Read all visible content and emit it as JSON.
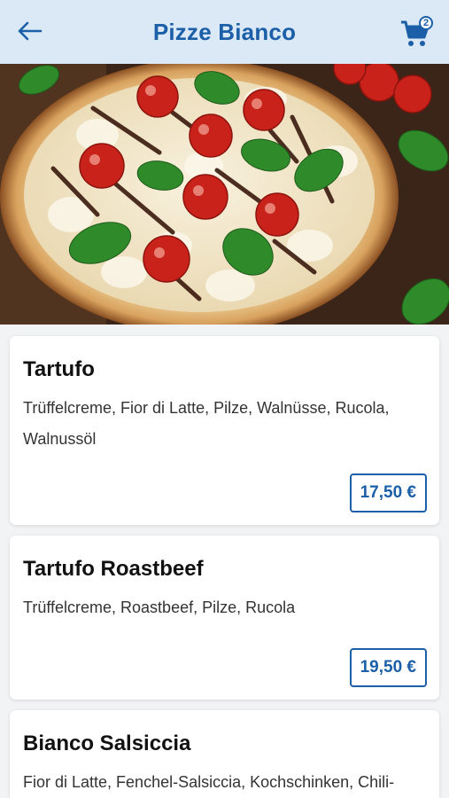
{
  "header": {
    "title": "Pizze Bianco",
    "cart_count": "2",
    "back_icon": "arrow-left-icon",
    "cart_icon": "shopping-cart-icon"
  },
  "colors": {
    "accent": "#1b5fa8",
    "header_bg": "#dbe9f6"
  },
  "items": [
    {
      "name": "Tartufo",
      "description": "Trüffelcreme, Fior di Latte, Pilze, Walnüsse, Rucola, Walnussöl",
      "price": "17,50 €"
    },
    {
      "name": "Tartufo Roastbeef",
      "description": "Trüffelcreme, Roastbeef, Pilze, Rucola",
      "price": "19,50 €"
    },
    {
      "name": "Bianco Salsiccia",
      "description": "Fior di Latte, Fenchel-Salsiccia, Kochschinken, Chili-"
    }
  ]
}
